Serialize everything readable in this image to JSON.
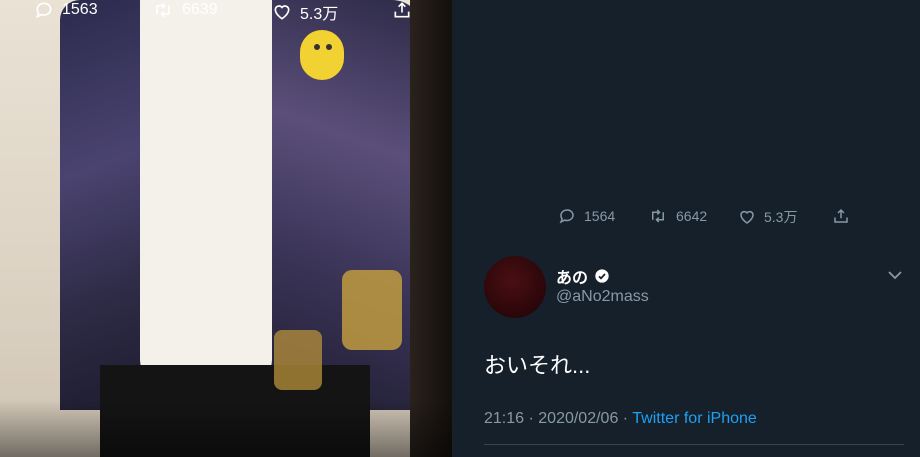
{
  "left_tweet": {
    "counts": {
      "replies": "1563",
      "retweets": "6639",
      "likes": "5.3万"
    }
  },
  "right_tweet_media": {
    "counts": {
      "replies": "1564",
      "retweets": "6642",
      "likes": "5.3万"
    }
  },
  "main_tweet": {
    "display_name": "あの",
    "handle": "@aNo2mass",
    "text": "おいそれ...",
    "time": "21:16",
    "date": "2020/02/06",
    "source": "Twitter for iPhone",
    "separator": " · "
  },
  "icons": [
    "reply-icon",
    "retweet-icon",
    "like-icon",
    "share-icon",
    "verified-badge-icon",
    "chevron-down-icon"
  ],
  "colors": {
    "background": "#15202b",
    "muted": "#8899a6",
    "link": "#1da1f2",
    "text": "#ffffff"
  }
}
